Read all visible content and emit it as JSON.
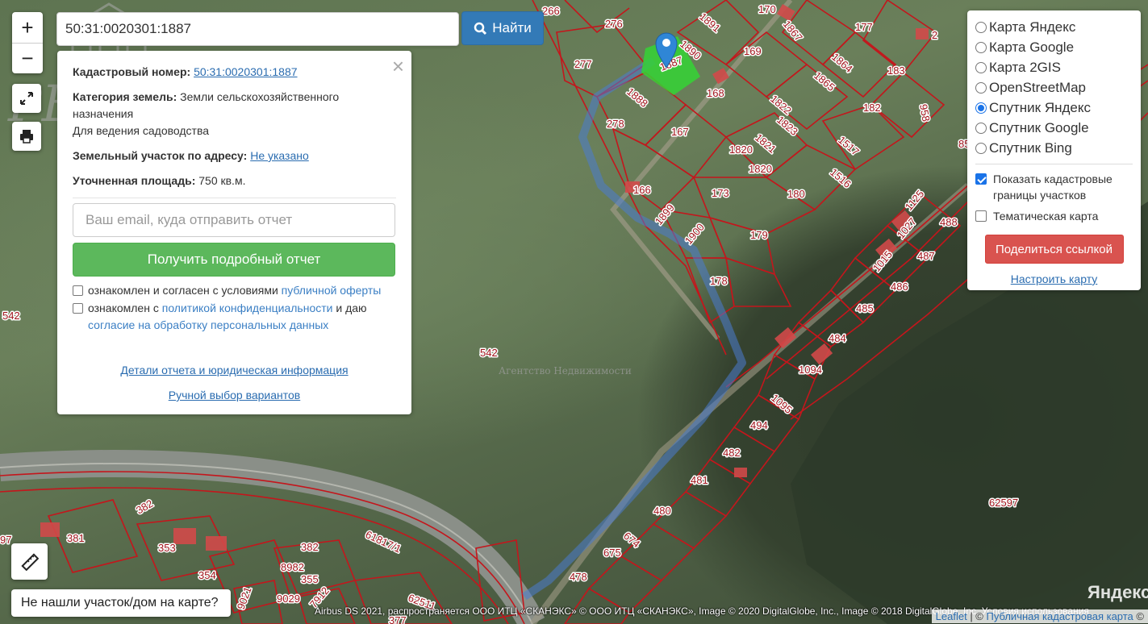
{
  "map": {
    "plots": [
      {
        "label": "266"
      },
      {
        "label": "276"
      },
      {
        "label": "1891"
      },
      {
        "label": "170"
      },
      {
        "label": "1867"
      },
      {
        "label": "177"
      },
      {
        "label": "277"
      },
      {
        "label": "1890"
      },
      {
        "label": "169"
      },
      {
        "label": "1864"
      },
      {
        "label": "183"
      },
      {
        "label": "2"
      },
      {
        "label": "1888"
      },
      {
        "label": "168"
      },
      {
        "label": "1865"
      },
      {
        "label": "958"
      },
      {
        "label": "278"
      },
      {
        "label": "167"
      },
      {
        "label": "1822"
      },
      {
        "label": "182"
      },
      {
        "label": "1823"
      },
      {
        "label": "1821"
      },
      {
        "label": "1517"
      },
      {
        "label": "1820"
      },
      {
        "label": "1820"
      },
      {
        "label": "1516"
      },
      {
        "label": "166"
      },
      {
        "label": "173"
      },
      {
        "label": "180"
      },
      {
        "label": "1899"
      },
      {
        "label": "1900"
      },
      {
        "label": "179"
      },
      {
        "label": "1125"
      },
      {
        "label": "488"
      },
      {
        "label": "1027"
      },
      {
        "label": "487"
      },
      {
        "label": "1015"
      },
      {
        "label": "178"
      },
      {
        "label": "486"
      },
      {
        "label": "485"
      },
      {
        "label": "484"
      },
      {
        "label": "1094"
      },
      {
        "label": "1095"
      },
      {
        "label": "494"
      },
      {
        "label": "482"
      },
      {
        "label": "481"
      },
      {
        "label": "480"
      },
      {
        "label": "674"
      },
      {
        "label": "675"
      },
      {
        "label": "478"
      },
      {
        "label": "62597"
      },
      {
        "label": "382"
      },
      {
        "label": "381"
      },
      {
        "label": "353"
      },
      {
        "label": "382"
      },
      {
        "label": "8982"
      },
      {
        "label": "354"
      },
      {
        "label": "355"
      },
      {
        "label": "9029"
      },
      {
        "label": "7912"
      },
      {
        "label": "9021"
      },
      {
        "label": "62511"
      },
      {
        "label": "61817/1"
      },
      {
        "label": "377"
      },
      {
        "label": "97"
      },
      {
        "label": "542"
      },
      {
        "label": "542"
      },
      {
        "label": "85"
      }
    ],
    "selected_plot_label": "1887",
    "watermark_title": "РЕАЛ",
    "watermark_subtitle": "Агентство Недвижимости",
    "yandex_logo": "Яндекс",
    "yandex_small": "Yandex"
  },
  "zoom": {
    "in_label": "+",
    "out_label": "−"
  },
  "search": {
    "value": "50:31:0020301:1887",
    "button_label": "Найти"
  },
  "info_panel": {
    "close_label": "×",
    "cad_number_label": "Кадастровый номер:",
    "cad_number_value": "50:31:0020301:1887",
    "category_label": "Категория земель:",
    "category_value": "Земли сельскохозяйственного назначения",
    "usage": "Для ведения садоводства",
    "address_label": "Земельный участок по адресу:",
    "address_value": "Не указано",
    "area_label": "Уточненная площадь:",
    "area_value": "750 кв.м.",
    "email_placeholder": "Ваш email, куда отправить отчет",
    "report_button": "Получить подробный отчет",
    "agree1_text": "ознакомлен и согласен с условиями",
    "agree1_link": "публичной оферты",
    "agree2_text": "ознакомлен с",
    "agree2_link": "политикой конфиденциальности",
    "agree2_tail": "и даю",
    "agree2_link2": "согласие на обработку персональных данных",
    "details_link": "Детали отчета и юридическая информация",
    "manual_link": "Ручной выбор вариантов"
  },
  "layers": {
    "options": [
      {
        "label": "Карта Яндекс",
        "selected": false
      },
      {
        "label": "Карта Google",
        "selected": false
      },
      {
        "label": "Карта 2GIS",
        "selected": false
      },
      {
        "label": "OpenStreetMap",
        "selected": false
      },
      {
        "label": "Спутник Яндекс",
        "selected": true
      },
      {
        "label": "Спутник Google",
        "selected": false
      },
      {
        "label": "Спутник Bing",
        "selected": false
      }
    ],
    "show_cadastral_label": "Показать кадастровые границы участков",
    "show_cadastral_checked": true,
    "thematic_label": "Тематическая карта",
    "thematic_checked": false,
    "share_button": "Поделиться ссылкой",
    "setup_link": "Настроить карту"
  },
  "bottom": {
    "not_found_button": "Не нашли участок/дом на карте?",
    "copyright": "Airbus DS 2021, распространяется ООО ИТЦ «СКАНЭКС» © ООО ИТЦ «СКАНЭКС», Image © 2020 DigitalGlobe, Inc., Image © 2018 DigitalGlobe, Inc.   Условия использования",
    "attr_leaflet": "Leaflet",
    "attr_sep": " | © ",
    "attr_source": "Публичная кадастровая карта",
    "attr_tail": " ©"
  },
  "colors": {
    "boundary": "#c4161c",
    "selected_plot": "#35d435",
    "marker": "#2f86d6",
    "route": "#4a7bd0",
    "search_button": "#337ab7",
    "report_button": "#5cb85c",
    "share_button": "#d9534f"
  }
}
